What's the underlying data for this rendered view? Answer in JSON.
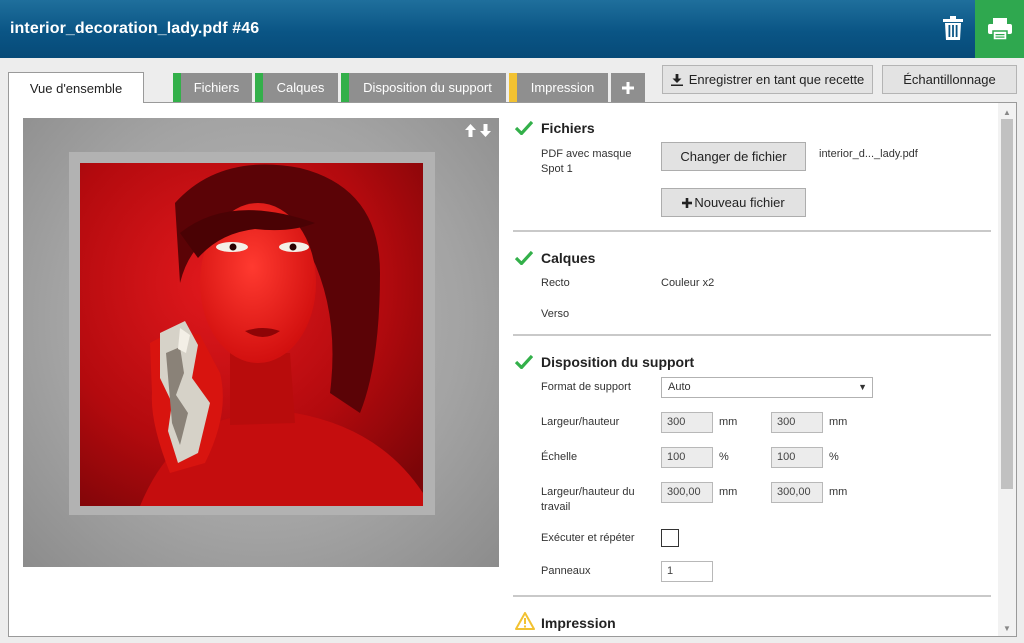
{
  "titlebar": {
    "title": "interior_decoration_lady.pdf #46"
  },
  "tabs": [
    {
      "label": "Vue d'ensemble",
      "status": "active"
    },
    {
      "label": "Fichiers",
      "status": "green"
    },
    {
      "label": "Calques",
      "status": "green"
    },
    {
      "label": "Disposition du support",
      "status": "green"
    },
    {
      "label": "Impression",
      "status": "yellow"
    }
  ],
  "actions": {
    "save_recipe": "Enregistrer en tant que recette",
    "sampling": "Échantillonnage"
  },
  "sections": {
    "files": {
      "title": "Fichiers",
      "file_type": "PDF avec masque Spot 1",
      "change_file": "Changer de fichier",
      "new_file": "Nouveau fichier",
      "file_name": "interior_d..._lady.pdf"
    },
    "layers": {
      "title": "Calques",
      "front_label": "Recto",
      "front_value": "Couleur x2",
      "back_label": "Verso"
    },
    "layout": {
      "title": "Disposition du support",
      "media_format_label": "Format de support",
      "media_format_value": "Auto",
      "width_height_label": "Largeur/hauteur",
      "width": "300",
      "height": "300",
      "unit_mm": "mm",
      "scale_label": "Échelle",
      "scale_x": "100",
      "scale_y": "100",
      "unit_pct": "%",
      "work_size_label": "Largeur/hauteur du travail",
      "work_width": "300,00",
      "work_height": "300,00",
      "step_repeat_label": "Exécuter et répéter",
      "panels_label": "Panneaux",
      "panels_value": "1"
    },
    "print": {
      "title": "Impression"
    }
  },
  "colors": {
    "titlebar": "#0a5585",
    "print_button": "#2fa84f",
    "status_ok": "#33b04a",
    "status_warn": "#f2c232",
    "artwork_red": "#c8090e"
  }
}
